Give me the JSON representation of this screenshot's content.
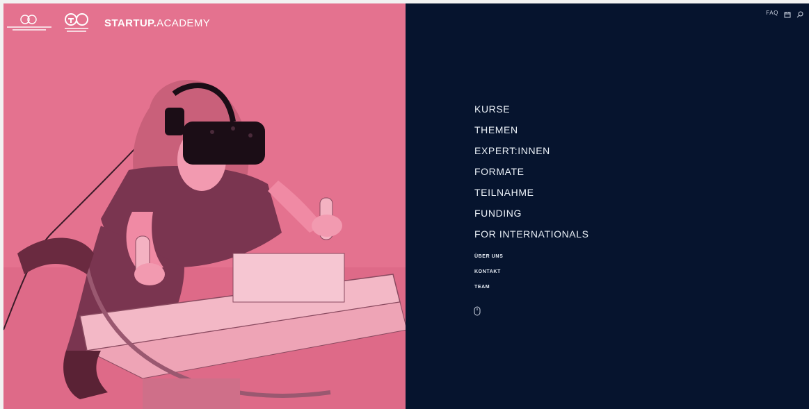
{
  "header": {
    "brand_bold": "STARTUP.",
    "brand_regular": "ACADEMY"
  },
  "topbar": {
    "faq_label": "FAQ"
  },
  "menu": {
    "items": [
      {
        "label": "KURSE"
      },
      {
        "label": "THEMEN"
      },
      {
        "label": "EXPERT:INNEN"
      },
      {
        "label": "FORMATE"
      },
      {
        "label": "TEILNAHME"
      },
      {
        "label": "FUNDING"
      },
      {
        "label": "FOR INTERNATIONALS"
      }
    ],
    "secondary": [
      {
        "label": "ÜBER UNS"
      },
      {
        "label": "KONTAKT"
      },
      {
        "label": "TEAM"
      }
    ]
  },
  "colors": {
    "hero_pink": "#e06e8c",
    "nav_navy": "#06142e",
    "text_light": "#eaf0f7"
  },
  "icons": {
    "topbar": [
      "calendar-icon",
      "search-icon"
    ],
    "scroll": "mouse-scroll-icon"
  }
}
